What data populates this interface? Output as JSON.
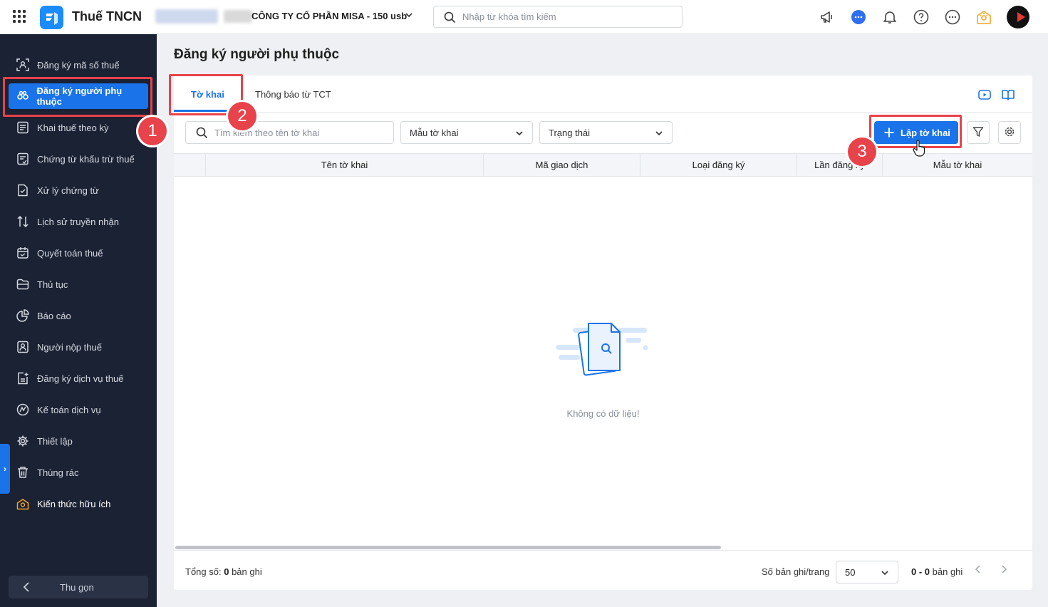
{
  "topbar": {
    "app_title": "Thuế TNCN",
    "company_name": "CÔNG TY CỔ PHẦN MISA - 150 usb",
    "search_placeholder": "Nhập từ khóa tìm kiếm",
    "icons": [
      "apps-grid-icon",
      "megaphone-icon",
      "chat-icon",
      "bell-icon",
      "help-icon",
      "more-icon",
      "knowledge-icon"
    ]
  },
  "sidebar": {
    "items": [
      {
        "label": "Đăng ký mã số thuế",
        "icon": "id-scan-icon"
      },
      {
        "label": "Đăng ký người phụ thuộc",
        "icon": "users-icon",
        "active": true
      },
      {
        "label": "Khai thuế theo kỳ",
        "icon": "document-icon"
      },
      {
        "label": "Chứng từ khấu trừ thuế",
        "icon": "receipt-icon"
      },
      {
        "label": "Xử lý chứng từ",
        "icon": "doc-check-icon"
      },
      {
        "label": "Lịch sử truyền nhận",
        "icon": "transfer-icon"
      },
      {
        "label": "Quyết toán thuế",
        "icon": "calendar-check-icon"
      },
      {
        "label": "Thủ tục",
        "icon": "folder-icon"
      },
      {
        "label": "Báo cáo",
        "icon": "pie-chart-icon"
      },
      {
        "label": "Người nộp thuế",
        "icon": "person-card-icon"
      },
      {
        "label": "Đăng ký dịch vụ thuế",
        "icon": "doc-plus-icon"
      },
      {
        "label": "Kế toán dịch vụ",
        "icon": "accounting-icon"
      },
      {
        "label": "Thiết lập",
        "icon": "gear-icon"
      },
      {
        "label": "Thùng rác",
        "icon": "trash-icon"
      },
      {
        "label": "Kiến thức hữu ích",
        "icon": "knowledge-icon"
      }
    ],
    "collapse_label": "Thu gọn"
  },
  "page": {
    "title": "Đăng ký người phụ thuộc"
  },
  "tabs": [
    {
      "label": "Tờ khai",
      "active": true
    },
    {
      "label": "Thông báo từ TCT"
    }
  ],
  "filters": {
    "search_placeholder": "Tìm kiếm theo tên tờ khai",
    "template_select": "Mẫu tờ khai",
    "status_select": "Trạng thái",
    "create_button": "Lập tờ khai"
  },
  "table": {
    "columns": [
      "",
      "Tên tờ khai",
      "Mã giao dịch",
      "Loại đăng ký",
      "Lần đăng ký",
      "Mẫu tờ khai"
    ],
    "rows": [],
    "empty_text": "Không có dữ liệu!"
  },
  "footer": {
    "total_label": "Tổng số:",
    "total_value": "0",
    "total_unit": "bản ghi",
    "per_page_label": "Số bản ghi/trang",
    "per_page_value": "50",
    "range_value": "0 - 0",
    "range_unit": "bản ghi"
  },
  "annotations": [
    "1",
    "2",
    "3"
  ],
  "colors": {
    "accent": "#1a73e8",
    "sidebar_bg": "#1b2233",
    "annotation": "#e8424a",
    "knowledge": "#f5a623"
  }
}
